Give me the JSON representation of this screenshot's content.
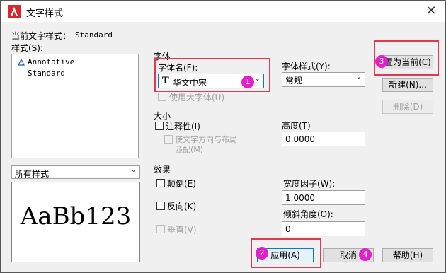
{
  "window": {
    "title": "文字样式",
    "close": "✕"
  },
  "current_style": {
    "label": "当前文字样式：",
    "value": "Standard"
  },
  "styles_label": "样式(S):",
  "styles": [
    "Annotative",
    "Standard"
  ],
  "filter": {
    "value": "所有样式"
  },
  "preview": {
    "text": "AaBb123"
  },
  "font": {
    "group": "字体",
    "name_label": "字体名(F):",
    "name_value": "华文中宋",
    "style_label": "字体样式(Y):",
    "style_value": "常规",
    "bigfont_label": "使用大字体(U)"
  },
  "size": {
    "group": "大小",
    "annotative_label": "注释性(I)",
    "match_label_line1": "使文字方向与布局",
    "match_label_line2": "匹配(M)",
    "height_label": "高度(T)",
    "height_value": "0.0000"
  },
  "effects": {
    "group": "效果",
    "upside_down": "颠倒(E)",
    "backwards": "反向(K)",
    "vertical": "垂直(V)",
    "width_label": "宽度因子(W):",
    "width_value": "1.0000",
    "oblique_label": "倾斜角度(O):",
    "oblique_value": "0"
  },
  "buttons": {
    "set_current": "置为当前(C)",
    "new": "新建(N)...",
    "delete": "删除(D)",
    "apply": "应用(A)",
    "cancel": "取消",
    "help": "帮助(H)"
  },
  "badges": [
    "1",
    "2",
    "3",
    "4"
  ],
  "colors": {
    "highlight": "#e03a50",
    "badge": "#e020c8",
    "title_icon": "#d9272e"
  }
}
